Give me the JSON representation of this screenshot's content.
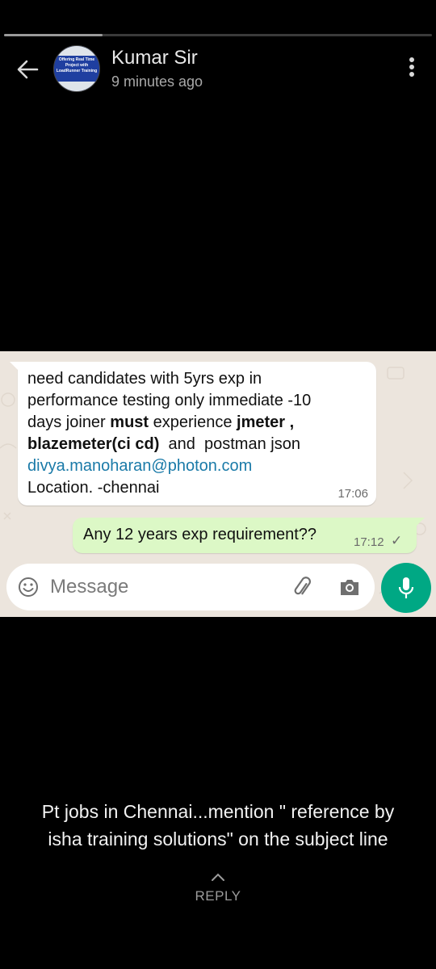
{
  "status": {
    "progress_fraction": 0.23
  },
  "header": {
    "contact_name": "Kumar Sir",
    "last_seen": "9 minutes ago",
    "avatar_text": "Offering Real Time Project with LoadRunner Training"
  },
  "chat": {
    "incoming": {
      "line1": "need candidates with 5yrs exp in",
      "line2": "performance testing only immediate -10",
      "line3_a": "days joiner ",
      "line3_b": "must",
      "line3_c": " experience ",
      "line3_d": "jmeter ,",
      "line4_a": "blazemeter(ci cd)",
      "line4_b": "  and  postman json",
      "email": "divya.manoharan@photon.com",
      "location": "Location. -chennai",
      "time": "17:06"
    },
    "outgoing": {
      "text": "Any 12 years exp requirement??",
      "time": "17:12",
      "tick": "✓"
    },
    "composer": {
      "placeholder": "Message"
    }
  },
  "caption": {
    "line1": "Pt jobs in Chennai...mention \" reference by",
    "line2": "isha training solutions\" on the subject line"
  },
  "reply": {
    "label": "REPLY"
  },
  "colors": {
    "accent": "#00a884",
    "outgoing_bubble": "#dcf8c6",
    "chat_bg": "#ece5dd",
    "link": "#1a7aa8"
  }
}
